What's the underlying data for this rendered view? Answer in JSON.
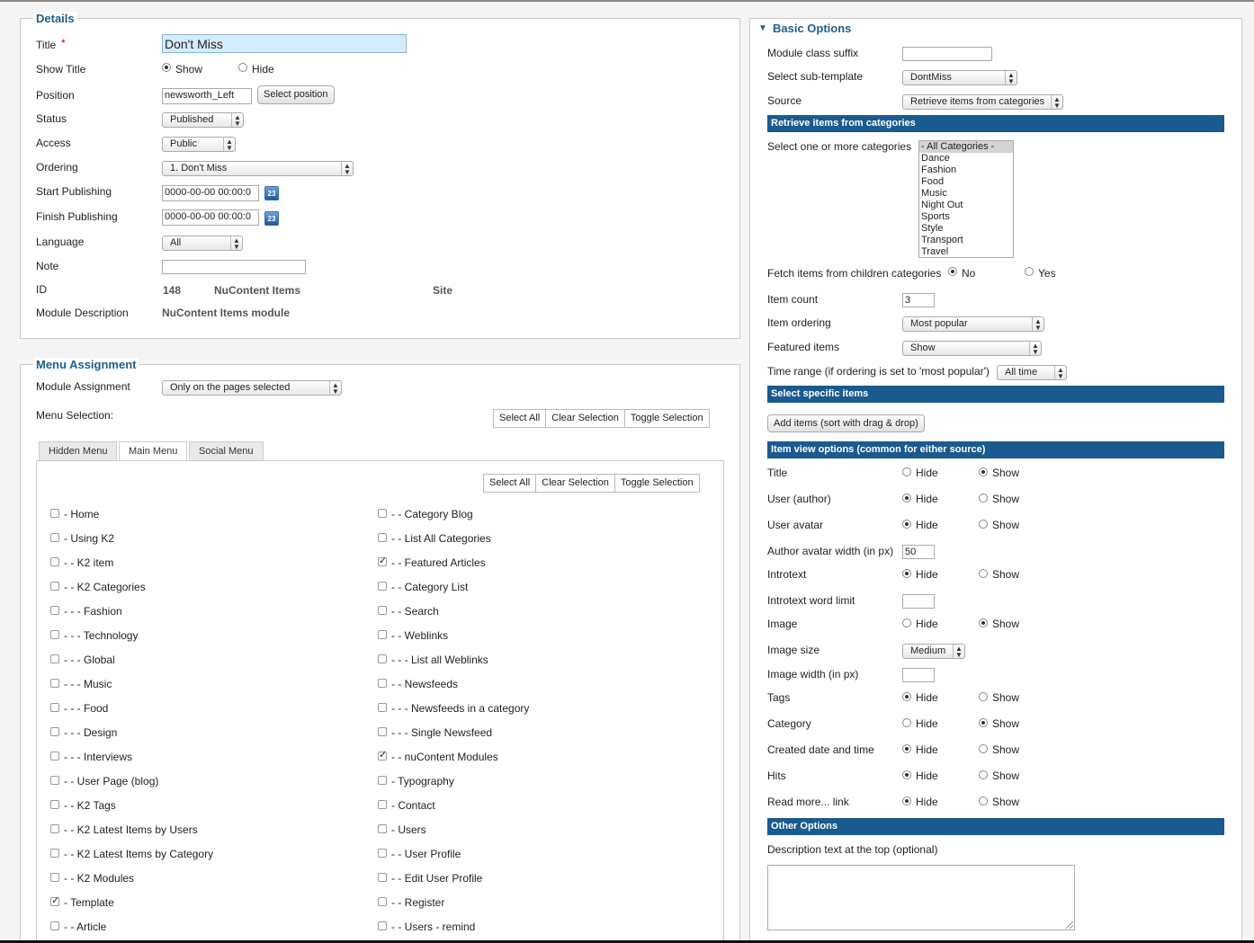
{
  "details": {
    "legend": "Details",
    "title_label": "Title",
    "title_required": "*",
    "title_value": "Don't Miss",
    "show_title_label": "Show Title",
    "show_title_show": "Show",
    "show_title_hide": "Hide",
    "position_label": "Position",
    "position_value": "newsworth_Left",
    "select_position_button": "Select position",
    "status_label": "Status",
    "status_value": "Published",
    "access_label": "Access",
    "access_value": "Public",
    "ordering_label": "Ordering",
    "ordering_value": "1. Don't Miss",
    "start_publishing_label": "Start Publishing",
    "start_publishing_value": "0000-00-00 00:00:0",
    "finish_publishing_label": "Finish Publishing",
    "finish_publishing_value": "0000-00-00 00:00:0",
    "calendar_icon_text": "23",
    "language_label": "Language",
    "language_value": "All",
    "note_label": "Note",
    "note_value": "",
    "id_label": "ID",
    "id_value": "148",
    "id_type": "NuContent Items",
    "id_client": "Site",
    "module_description_label": "Module Description",
    "module_description_value": "NuContent Items module"
  },
  "menu_assignment": {
    "legend": "Menu Assignment",
    "module_assignment_label": "Module Assignment",
    "module_assignment_value": "Only on the pages selected",
    "menu_selection_label": "Menu Selection:",
    "select_all": "Select All",
    "clear_selection": "Clear Selection",
    "toggle_selection": "Toggle Selection",
    "tabs": [
      "Hidden Menu",
      "Main Menu",
      "Social Menu"
    ],
    "left_items": [
      {
        "label": "- Home",
        "checked": false
      },
      {
        "label": "- Using K2",
        "checked": false
      },
      {
        "label": "- - K2 item",
        "checked": false
      },
      {
        "label": "- - K2 Categories",
        "checked": false
      },
      {
        "label": "- - - Fashion",
        "checked": false
      },
      {
        "label": "- - - Technology",
        "checked": false
      },
      {
        "label": "- - - Global",
        "checked": false
      },
      {
        "label": "- - - Music",
        "checked": false
      },
      {
        "label": "- - - Food",
        "checked": false
      },
      {
        "label": "- - - Design",
        "checked": false
      },
      {
        "label": "- - - Interviews",
        "checked": false
      },
      {
        "label": "- - User Page (blog)",
        "checked": false
      },
      {
        "label": "- - K2 Tags",
        "checked": false
      },
      {
        "label": "- - K2 Latest Items by Users",
        "checked": false
      },
      {
        "label": "- - K2 Latest Items by Category",
        "checked": false
      },
      {
        "label": "- - K2 Modules",
        "checked": false
      },
      {
        "label": "- Template",
        "checked": true
      },
      {
        "label": "- - Article",
        "checked": false
      }
    ],
    "right_items": [
      {
        "label": "- - Category Blog",
        "checked": false
      },
      {
        "label": "- - List All Categories",
        "checked": false
      },
      {
        "label": "- - Featured Articles",
        "checked": true
      },
      {
        "label": "- - Category List",
        "checked": false
      },
      {
        "label": "- - Search",
        "checked": false
      },
      {
        "label": "- - Weblinks",
        "checked": false
      },
      {
        "label": "- - - List all Weblinks",
        "checked": false
      },
      {
        "label": "- - Newsfeeds",
        "checked": false
      },
      {
        "label": "- - - Newsfeeds in a category",
        "checked": false
      },
      {
        "label": "- - - Single Newsfeed",
        "checked": false
      },
      {
        "label": "- - nuContent Modules",
        "checked": true
      },
      {
        "label": "- Typography",
        "checked": false
      },
      {
        "label": "- Contact",
        "checked": false
      },
      {
        "label": "- Users",
        "checked": false
      },
      {
        "label": "- - User Profile",
        "checked": false
      },
      {
        "label": "- - Edit User Profile",
        "checked": false
      },
      {
        "label": "- - Register",
        "checked": false
      },
      {
        "label": "- - Users - remind",
        "checked": false
      }
    ]
  },
  "basic_options": {
    "header": "Basic Options",
    "module_class_suffix_label": "Module class suffix",
    "module_class_suffix_value": "",
    "sub_template_label": "Select sub-template",
    "sub_template_value": "DontMiss",
    "source_label": "Source",
    "source_value": "Retrieve items from categories",
    "bar_categories": "Retrieve items from categories",
    "categories_label": "Select one or more categories",
    "categories": [
      "- All Categories -",
      "Dance",
      "Fashion",
      "Food",
      "Music",
      "Night Out",
      "Sports",
      "Style",
      "Transport",
      "Travel"
    ],
    "fetch_children_label": "Fetch items from children categories",
    "fetch_no": "No",
    "fetch_yes": "Yes",
    "item_count_label": "Item count",
    "item_count_value": "3",
    "item_ordering_label": "Item ordering",
    "item_ordering_value": "Most popular",
    "featured_items_label": "Featured items",
    "featured_items_value": "Show",
    "time_range_label": "Time range (if ordering is set to 'most popular')",
    "time_range_value": "All time",
    "bar_specific": "Select specific items",
    "add_items_button": "Add items (sort with drag & drop)",
    "bar_view_options": "Item view options (common for either source)",
    "hide": "Hide",
    "show": "Show",
    "view_options": [
      {
        "label": "Title",
        "value": "Show"
      },
      {
        "label": "User (author)",
        "value": "Hide"
      },
      {
        "label": "User avatar",
        "value": "Hide"
      }
    ],
    "avatar_width_label": "Author avatar width (in px)",
    "avatar_width_value": "50",
    "introtext_label": "Introtext",
    "introtext_limit_label": "Introtext word limit",
    "image_label": "Image",
    "image_size_label": "Image size",
    "image_size_value": "Medium",
    "image_width_label": "Image width (in px)",
    "tags_label": "Tags",
    "category_label": "Category",
    "created_label": "Created date and time",
    "hits_label": "Hits",
    "readmore_label": "Read more... link",
    "bar_other": "Other Options",
    "description_label": "Description text at the top (optional)"
  }
}
